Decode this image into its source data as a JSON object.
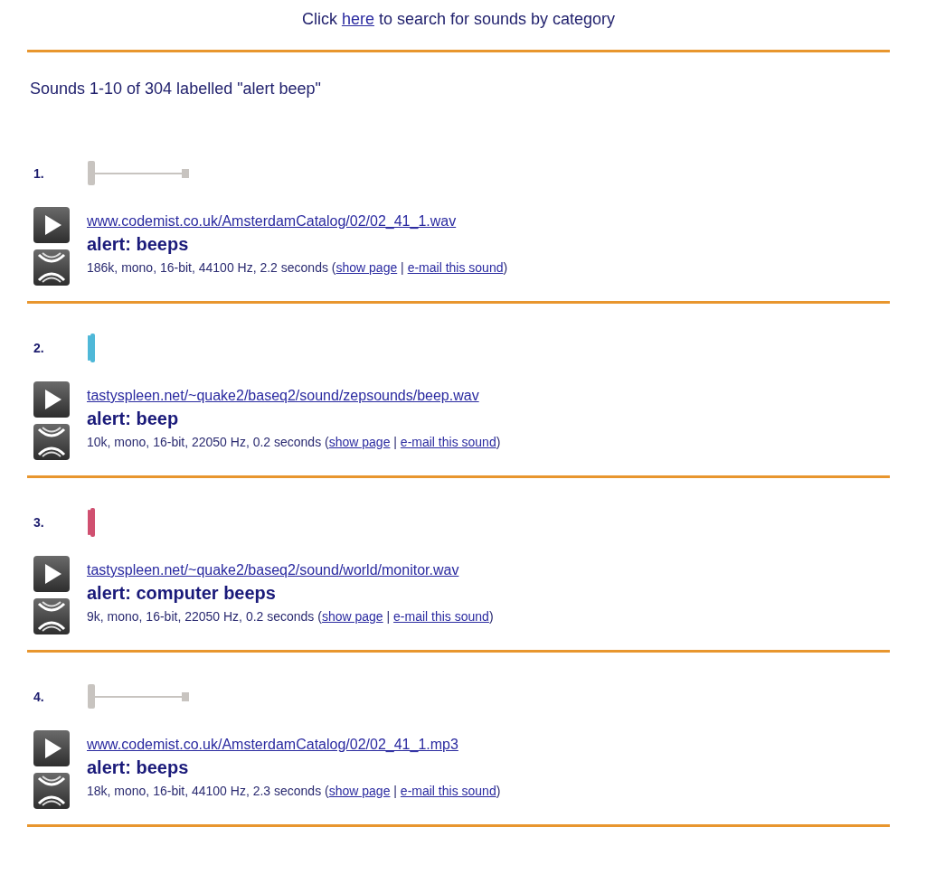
{
  "header": {
    "before": "Click ",
    "link": "here",
    "after": " to search for sounds by category"
  },
  "summary": "Sounds 1-10 of 304 labelled \"alert beep\"",
  "sounds": [
    {
      "number": "1.",
      "waveform": {
        "kind": "flat",
        "color": "#c8c4c0"
      },
      "url": "www.codemist.co.uk/AmsterdamCatalog/02/02_41_1.wav",
      "title": "alert: beeps",
      "info": "186k, mono, 16-bit, 44100 Hz, 2.2 seconds (",
      "show_page": "show page",
      "separator": " | ",
      "email": "e-mail this sound",
      "close": ")"
    },
    {
      "number": "2.",
      "waveform": {
        "kind": "burst",
        "color": "#4fb8d8"
      },
      "url": "tastyspleen.net/~quake2/baseq2/sound/zepsounds/beep.wav",
      "title": "alert: beep",
      "info": "10k, mono, 16-bit, 22050 Hz, 0.2 seconds (",
      "show_page": "show page",
      "separator": " | ",
      "email": "e-mail this sound",
      "close": ")"
    },
    {
      "number": "3.",
      "waveform": {
        "kind": "burst",
        "color": "#d05070"
      },
      "url": "tastyspleen.net/~quake2/baseq2/sound/world/monitor.wav",
      "title": "alert: computer beeps",
      "info": "9k, mono, 16-bit, 22050 Hz, 0.2 seconds (",
      "show_page": "show page",
      "separator": " | ",
      "email": "e-mail this sound",
      "close": ")"
    },
    {
      "number": "4.",
      "waveform": {
        "kind": "flat",
        "color": "#c8c4c0"
      },
      "url": "www.codemist.co.uk/AmsterdamCatalog/02/02_41_1.mp3",
      "title": "alert: beeps",
      "info": "18k, mono, 16-bit, 44100 Hz, 2.3 seconds (",
      "show_page": "show page",
      "separator": " | ",
      "email": "e-mail this sound",
      "close": ")"
    }
  ]
}
